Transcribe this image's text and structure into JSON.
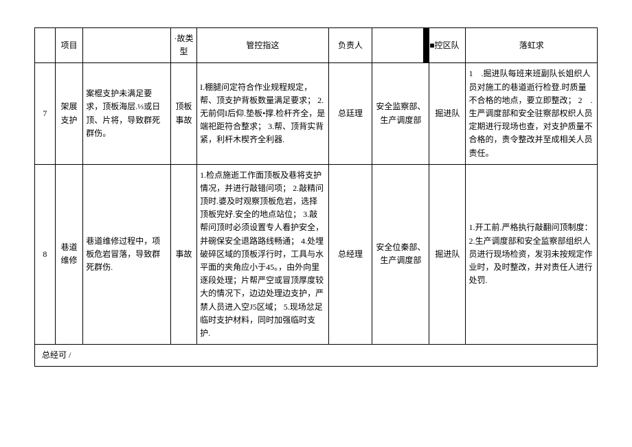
{
  "headers": {
    "project": "项目",
    "type": "·故类型",
    "control": "管控指这",
    "responsible": "负责人",
    "team_marker": "■控区队",
    "requirement": "落虹求"
  },
  "rows": [
    {
      "num": "7",
      "project": "架展支护",
      "risk_desc": "案棍支护未满足要求，顶板海层.⅓或日顶、片将，导致群死群伤。",
      "type": "顶板事故",
      "control": "I.棚腿问定符合作业规程规定，帮、顶支护背板数量满足要求；\n2.无前伺I后仰.垫板•撑.检杆齐全，是端祀距符合整求；\n3.帮、顶背实背紧，利杆木楔齐全利器.",
      "responsible": "总廷理",
      "department": "安全监察部、生产调度部",
      "team": "掘进队",
      "requirement": "1　.掘进队每班来班副队长姐织人员对施工的巷道逝行检登.时质量不合格的地点，要立即整改；\n2　.生严调度部和安全驻察部权织人员定期进行现场也查，对支护质量不合格的，责令整改并至成相关人员责任。"
    },
    {
      "num": "8",
      "project": "巷道维修",
      "risk_desc": "巷道维修过程中，项板危岩冒落，导致群死群伤.",
      "type": "事故",
      "control": "1.检点施逝工作面顶板及巷将支护情况，并进行敲错问项；\n2.敲精问顶时.婆及时观察顶板危岩，选择顶板完好.安全的地点站位；\n3.敲帮问顶时必须设置专人看护安全，并碗保安全退路路线畅通；\n4.处埋破碎区域的顶板浮行时，工具与水平面的夹角应小于45。，由外向里逐段处理；片帮严空或冒顶厚度较大的情况下，边边处理边支护，严禁人员进入空J5区域；\n5.现场忿足临时支护材料，同时加强临时支护.",
      "responsible": "总经理",
      "department": "安全位秦部、生产调度部",
      "team": "掘进队",
      "requirement": "1.开工前.严格执行敲翻问顶制度：2.生产调度部和安全监察部组织人员进行现场检资，发羽未按规定作业时，及时整改，并对责任人进行处罚."
    }
  ],
  "footer": "总经可 /"
}
